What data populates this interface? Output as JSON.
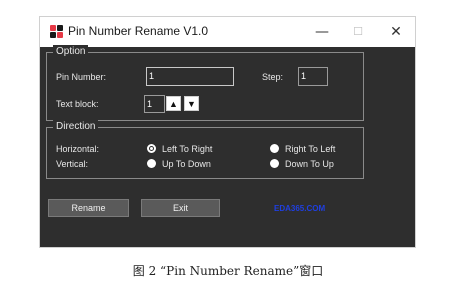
{
  "window": {
    "title": "Pin Number Rename V1.0",
    "minimize_glyph": "—",
    "maximize_glyph": "☐",
    "close_glyph": "✕",
    "icon_colors": [
      "#e63946",
      "#ffffff",
      "#ffffff",
      "#e63946"
    ]
  },
  "option": {
    "group_title": "Option",
    "pin_number_label": "Pin Number:",
    "pin_number_value": "1",
    "step_label": "Step:",
    "step_value": "1",
    "text_block_label": "Text block:",
    "text_block_value": "1",
    "up_glyph": "▲",
    "down_glyph": "▼"
  },
  "direction": {
    "group_title": "Direction",
    "horizontal_label": "Horizontal:",
    "vertical_label": "Vertical:",
    "left_to_right": "Left To Right",
    "right_to_left": "Right To Left",
    "up_to_down": "Up To Down",
    "down_to_up": "Down To Up",
    "selected": [
      "left_to_right"
    ]
  },
  "buttons": {
    "rename": "Rename",
    "exit": "Exit"
  },
  "link": "EDA365.COM",
  "caption": "图 2 “Pin Number Rename”窗口",
  "colors": {
    "window_bg": "#2e2e2e",
    "link": "#1f3fe0"
  }
}
